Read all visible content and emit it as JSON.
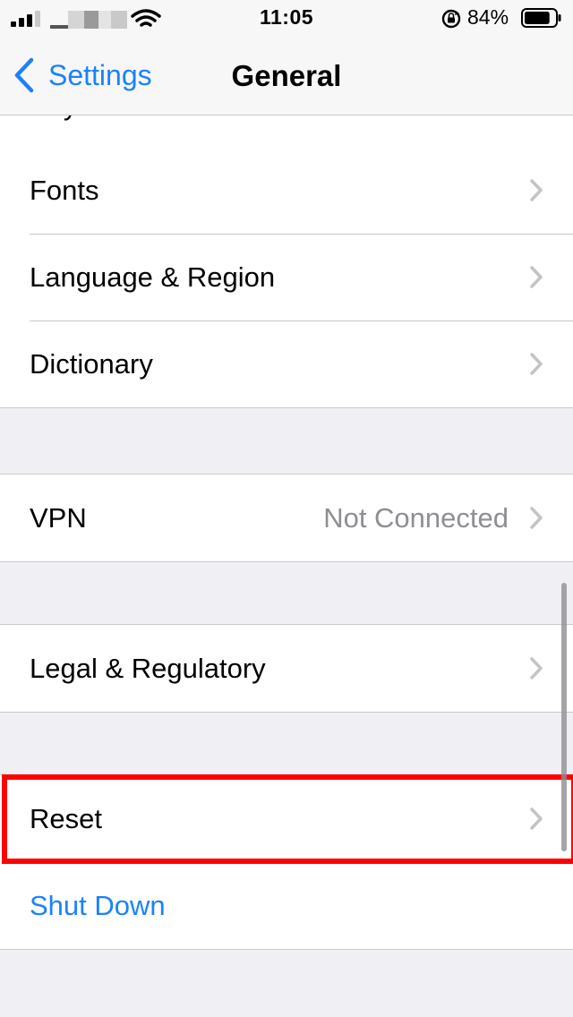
{
  "status_bar": {
    "time": "11:05",
    "battery_percent": "84%",
    "signal_bars": 3,
    "battery_level": 0.84
  },
  "nav": {
    "back_label": "Settings",
    "title": "General"
  },
  "list": {
    "partial_row_label": "Keyboard",
    "group1": [
      {
        "label": "Fonts"
      },
      {
        "label": "Language & Region"
      },
      {
        "label": "Dictionary"
      }
    ],
    "vpn": {
      "label": "VPN",
      "value": "Not Connected"
    },
    "legal": {
      "label": "Legal & Regulatory"
    },
    "reset": {
      "label": "Reset"
    },
    "shutdown": {
      "label": "Shut Down"
    }
  },
  "colors": {
    "accent": "#1a82fb",
    "highlight": "#ff0000",
    "secondary_text": "#8e8e93",
    "background": "#efeff4"
  }
}
